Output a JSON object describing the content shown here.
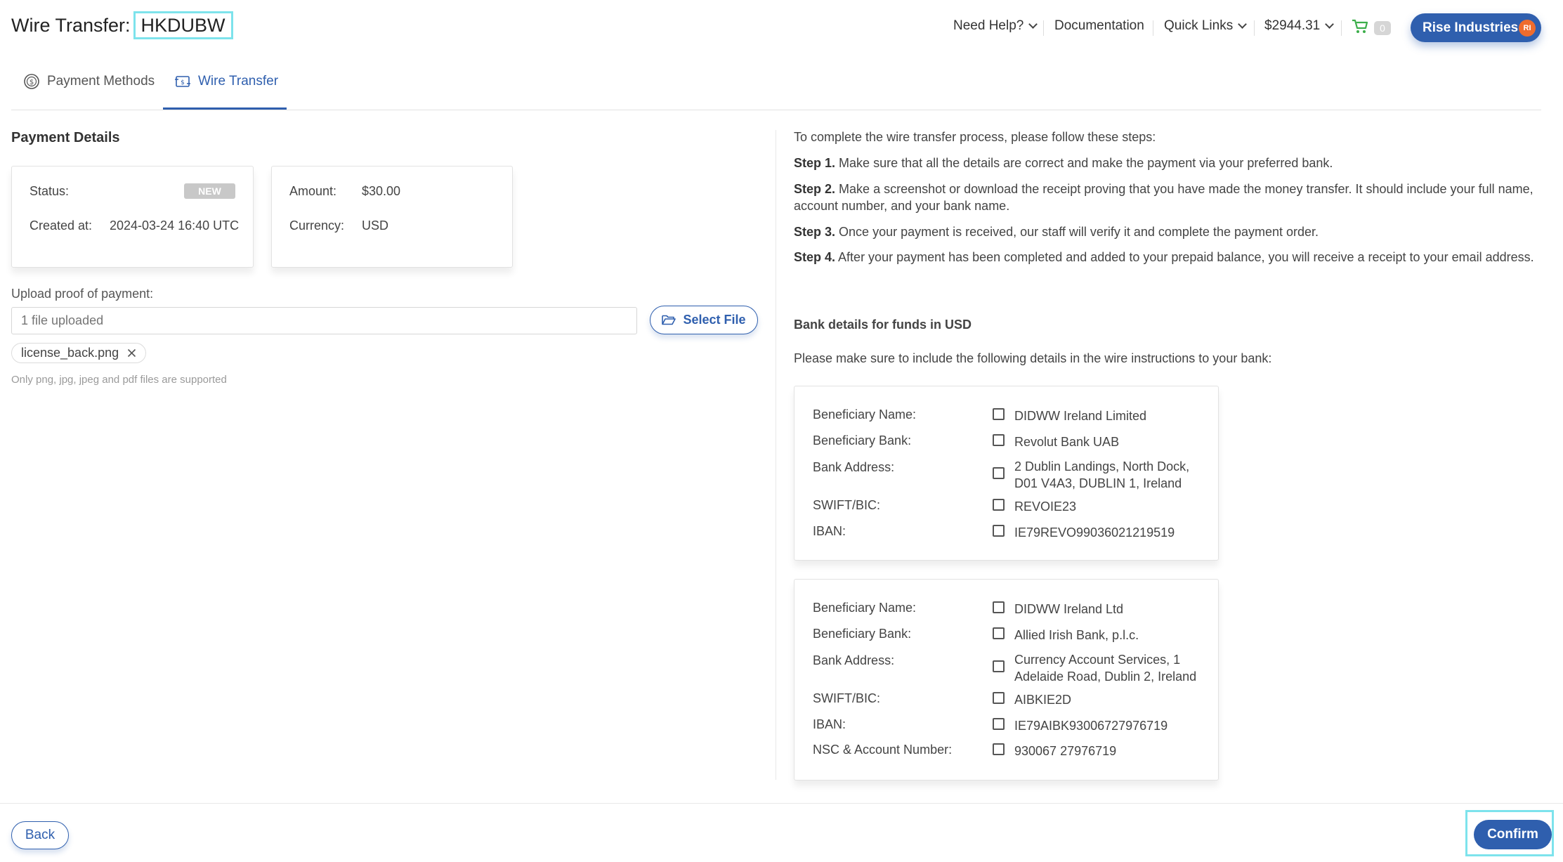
{
  "header": {
    "title_prefix": "Wire Transfer:",
    "title_code": "HKDUBW",
    "nav": {
      "need_help": "Need Help?",
      "documentation": "Documentation",
      "quick_links": "Quick Links",
      "balance": "$2944.31",
      "cart_count": "0"
    },
    "user": {
      "name": "Rise Industries",
      "initials": "RI"
    }
  },
  "tabs": [
    {
      "label": "Payment Methods",
      "icon": "dollar-circle-icon",
      "active": false
    },
    {
      "label": "Wire Transfer",
      "icon": "money-transfer-icon",
      "active": true
    }
  ],
  "payment_details": {
    "heading": "Payment Details",
    "status_label": "Status:",
    "status_value": "NEW",
    "created_label": "Created at:",
    "created_value": "2024-03-24 16:40 UTC",
    "amount_label": "Amount:",
    "amount_value": "$30.00",
    "currency_label": "Currency:",
    "currency_value": "USD"
  },
  "upload": {
    "label": "Upload proof of payment:",
    "placeholder": "1 file uploaded",
    "select_button": "Select File",
    "file_name": "license_back.png",
    "note": "Only png, jpg, jpeg and pdf files are supported"
  },
  "instructions": {
    "intro": "To complete the wire transfer process, please follow these steps:",
    "steps": [
      {
        "label": "Step 1.",
        "text": "Make sure that all the details are correct and make the payment via your preferred bank."
      },
      {
        "label": "Step 2.",
        "text": "Make a screenshot or download the receipt proving that you have made the money transfer. It should include your full name, account number, and your bank name."
      },
      {
        "label": "Step 3.",
        "text": "Once your payment is received, our staff will verify it and complete the payment order."
      },
      {
        "label": "Step 4.",
        "text": "After your payment has been completed and added to your prepaid balance, you will receive a receipt to your email address."
      }
    ]
  },
  "bank": {
    "heading": "Bank details for funds in USD",
    "note": "Please make sure to include the following details in the wire instructions to your bank:",
    "accounts": [
      {
        "rows": [
          {
            "label": "Beneficiary Name:",
            "value": "DIDWW Ireland Limited"
          },
          {
            "label": "Beneficiary Bank:",
            "value": "Revolut Bank UAB"
          },
          {
            "label": "Bank Address:",
            "value": "2 Dublin Landings, North Dock, D01 V4A3, DUBLIN 1, Ireland"
          },
          {
            "label": "SWIFT/BIC:",
            "value": "REVOIE23"
          },
          {
            "label": "IBAN:",
            "value": "IE79REVO99036021219519"
          }
        ]
      },
      {
        "rows": [
          {
            "label": "Beneficiary Name:",
            "value": "DIDWW Ireland Ltd"
          },
          {
            "label": "Beneficiary Bank:",
            "value": "Allied Irish Bank, p.l.c."
          },
          {
            "label": "Bank Address:",
            "value": "Currency Account Services, 1 Adelaide Road, Dublin 2, Ireland"
          },
          {
            "label": "SWIFT/BIC:",
            "value": "AIBKIE2D"
          },
          {
            "label": "IBAN:",
            "value": "IE79AIBK93006727976719"
          },
          {
            "label": "NSC & Account Number:",
            "value": "930067 27976719"
          }
        ]
      }
    ]
  },
  "footer": {
    "back": "Back",
    "confirm": "Confirm"
  },
  "colors": {
    "primary": "#2f5fae",
    "highlight": "#7de3ec",
    "avatar": "#ef6c2d",
    "cart": "#3cae4a",
    "badge": "#c8c8c8"
  }
}
